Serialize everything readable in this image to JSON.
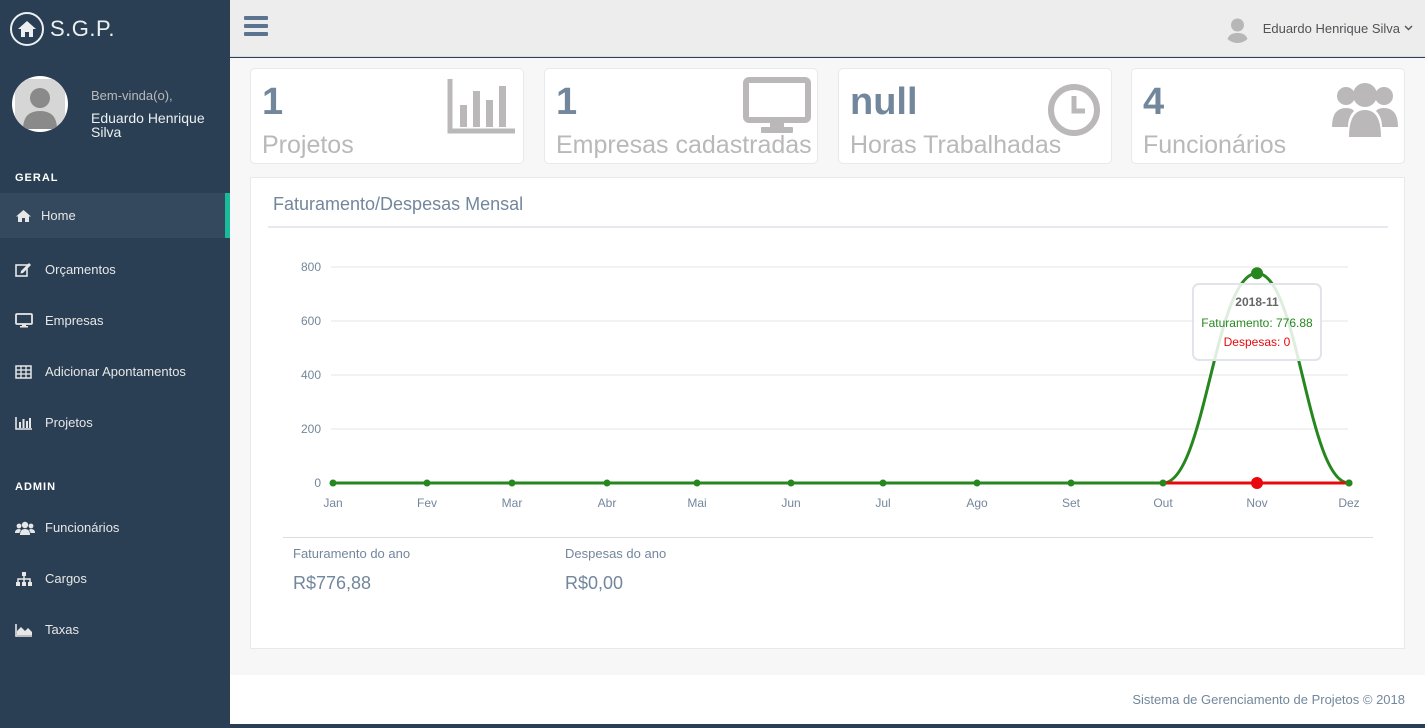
{
  "brand": {
    "name": "S.G.P.",
    "icon": "home-icon"
  },
  "profile": {
    "welcome": "Bem-vinda(o),",
    "name": "Eduardo Henrique Silva"
  },
  "sidebar": {
    "geral_title": "GERAL",
    "admin_title": "ADMIN",
    "geral_items": [
      {
        "label": "Home",
        "icon": "home-icon",
        "active": true
      },
      {
        "label": "Orçamentos",
        "icon": "edit-icon"
      },
      {
        "label": "Empresas",
        "icon": "desktop-icon"
      },
      {
        "label": "Adicionar Apontamentos",
        "icon": "table-icon"
      },
      {
        "label": "Projetos",
        "icon": "bar-chart-icon"
      }
    ],
    "admin_items": [
      {
        "label": "Funcionários",
        "icon": "users-icon"
      },
      {
        "label": "Cargos",
        "icon": "sitemap-icon"
      },
      {
        "label": "Taxas",
        "icon": "area-chart-icon"
      }
    ]
  },
  "topnav": {
    "user_name": "Eduardo Henrique Silva"
  },
  "tiles": [
    {
      "count": "1",
      "label": "Projetos",
      "icon": "bar-chart-icon"
    },
    {
      "count": "1",
      "label": "Empresas cadastradas",
      "icon": "desktop-icon"
    },
    {
      "count": "null",
      "label": "Horas Trabalhadas",
      "icon": "clock-icon"
    },
    {
      "count": "4",
      "label": "Funcionários",
      "icon": "users-icon"
    }
  ],
  "panel": {
    "title": "Faturamento/Despesas Mensal",
    "summary": [
      {
        "label": "Faturamento do ano",
        "value": "R$776,88"
      },
      {
        "label": "Despesas do ano",
        "value": "R$0,00"
      }
    ]
  },
  "chart_data": {
    "type": "line",
    "categories": [
      "Jan",
      "Fev",
      "Mar",
      "Abr",
      "Mai",
      "Jun",
      "Jul",
      "Ago",
      "Set",
      "Out",
      "Nov",
      "Dez"
    ],
    "ylim": [
      0,
      800
    ],
    "yticks": [
      "800",
      "600",
      "400",
      "200",
      "0"
    ],
    "grid": true,
    "series": [
      {
        "name": "Faturamento",
        "color": "#26871f",
        "values": [
          0,
          0,
          0,
          0,
          0,
          0,
          0,
          0,
          0,
          0,
          776.88,
          0
        ]
      },
      {
        "name": "Despesas",
        "color": "#e8090c",
        "values": [
          0,
          0,
          0,
          0,
          0,
          0,
          0,
          0,
          0,
          0,
          0,
          0
        ]
      }
    ],
    "tooltip": {
      "title": "2018-11",
      "lines": [
        "Faturamento: 776.88",
        "Despesas: 0"
      ]
    }
  },
  "footer": {
    "text": "Sistema de Gerenciamento de Projetos © 2018"
  }
}
